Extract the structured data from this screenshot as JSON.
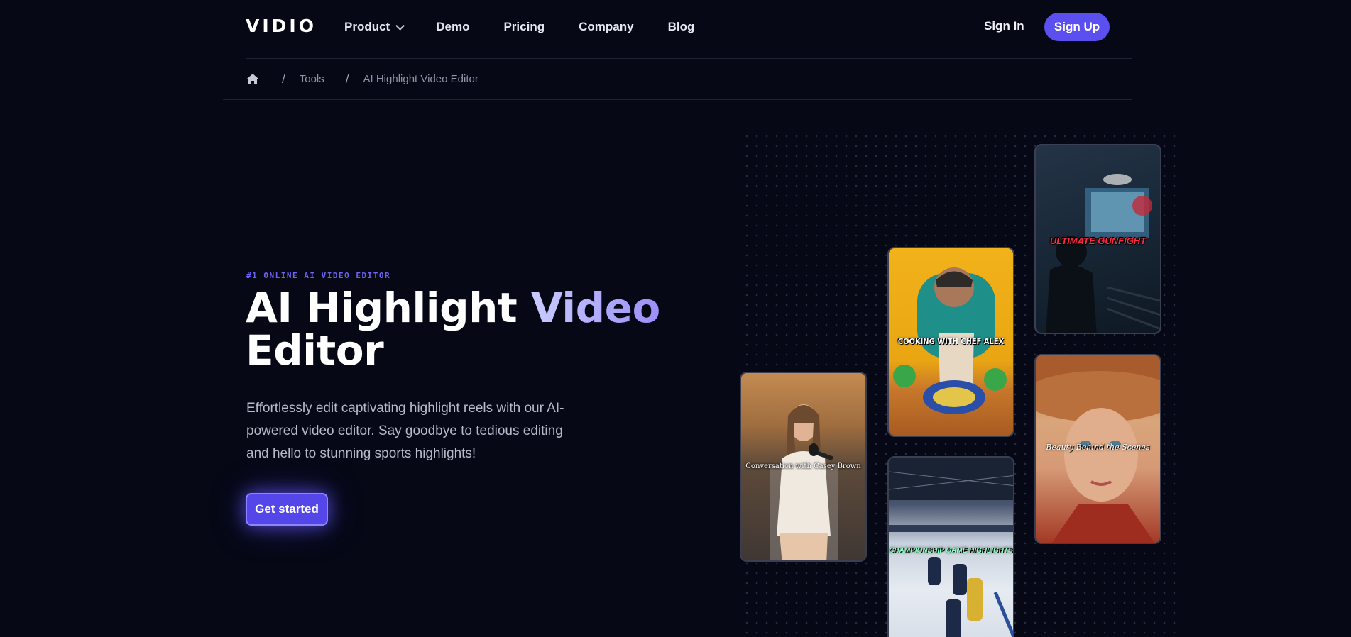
{
  "header": {
    "logo": "VIDIO",
    "nav": [
      {
        "label": "Product",
        "has_dropdown": true
      },
      {
        "label": "Demo"
      },
      {
        "label": "Pricing"
      },
      {
        "label": "Company"
      },
      {
        "label": "Blog"
      }
    ],
    "sign_in": "Sign In",
    "sign_up": "Sign Up"
  },
  "breadcrumb": {
    "home_icon": "home-icon",
    "items": [
      "Tools",
      "AI Highlight Video Editor"
    ],
    "separator": "/"
  },
  "hero": {
    "eyebrow": "#1 ONLINE AI VIDEO EDITOR",
    "title_part1": "AI Highlight ",
    "title_accent": "Video",
    "title_part2": "Editor",
    "description": "Effortlessly edit captivating highlight reels with our AI-powered video editor. Say goodbye to tedious editing and hello to stunning sports highlights!",
    "cta": "Get started"
  },
  "cards": [
    {
      "caption": "Conversation with Casey Brown"
    },
    {
      "caption": "COOKING WITH CHEF ALEX"
    },
    {
      "caption": "CHAMPIONSHIP GAME HIGHLIGHTS"
    },
    {
      "caption": "ULTIMATE GUNFIGHT"
    },
    {
      "caption": "Beauty Behind the Scenes"
    }
  ],
  "colors": {
    "background": "#060815",
    "accent": "#5b4ff0",
    "eyebrow": "#6f63f5"
  }
}
